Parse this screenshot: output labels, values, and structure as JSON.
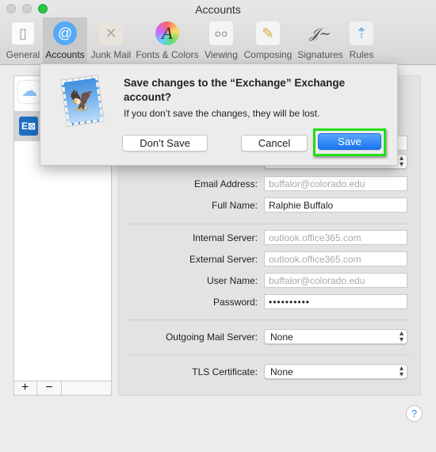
{
  "window": {
    "title": "Accounts"
  },
  "toolbar": [
    {
      "label": "General",
      "icon": "general-icon"
    },
    {
      "label": "Accounts",
      "icon": "at-icon"
    },
    {
      "label": "Junk Mail",
      "icon": "trash-icon"
    },
    {
      "label": "Fonts & Colors",
      "icon": "font-icon"
    },
    {
      "label": "Viewing",
      "icon": "glasses-icon"
    },
    {
      "label": "Composing",
      "icon": "pencil-icon"
    },
    {
      "label": "Signatures",
      "icon": "signature-icon"
    },
    {
      "label": "Rules",
      "icon": "rules-icon"
    }
  ],
  "sidebar": {
    "add": "+",
    "remove": "−",
    "accounts": [
      {
        "icon": "icloud-icon"
      },
      {
        "icon": "exchange-icon"
      }
    ]
  },
  "form": {
    "email_label": "Email Address:",
    "email_placeholder": "buffalor@colorado.edu",
    "fullname_label": "Full Name:",
    "fullname_value": "Ralphie Buffalo",
    "internal_label": "Internal Server:",
    "internal_placeholder": "outlook.office365.com",
    "external_label": "External Server:",
    "external_placeholder": "outlook.office365.com",
    "username_label": "User Name:",
    "username_placeholder": "buffalor@colorado.edu",
    "password_label": "Password:",
    "password_value": "••••••••••",
    "outgoing_label": "Outgoing Mail Server:",
    "outgoing_value": "None",
    "tls_label": "TLS Certificate:",
    "tls_value": "None"
  },
  "dialog": {
    "title_line1": "Save changes to the “Exchange” Exchange",
    "title_line2": "account?",
    "message": "If you don’t save the changes, they will be lost.",
    "dont_save": "Don’t Save",
    "cancel": "Cancel",
    "save": "Save",
    "highlight_color": "#22e01a",
    "accent": "#2f86f6"
  },
  "help": "?"
}
